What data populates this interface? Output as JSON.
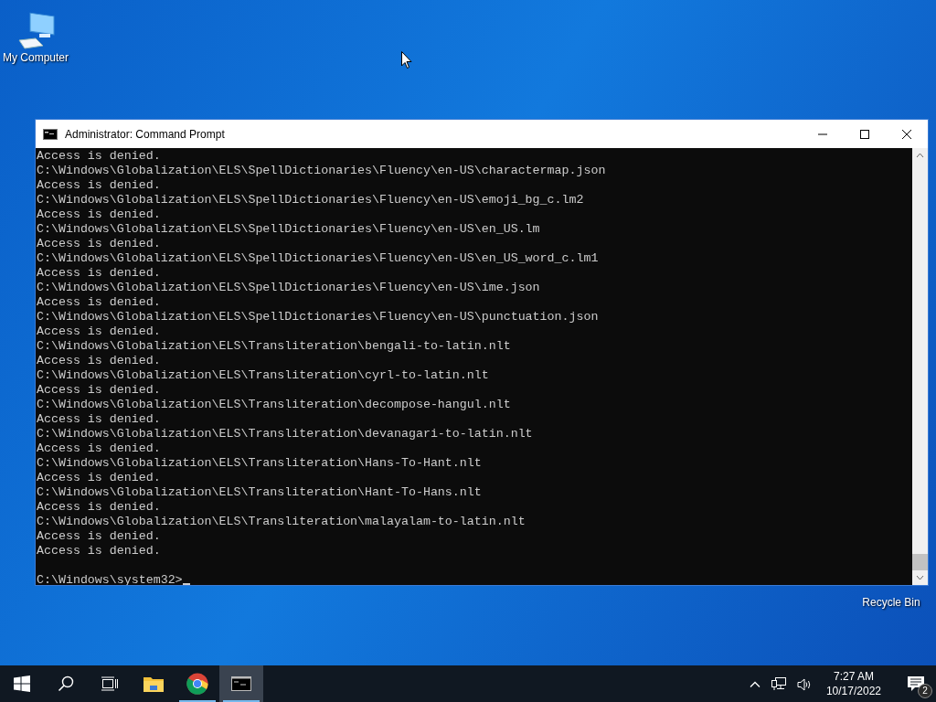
{
  "desktop_icons": [
    {
      "kind": "computer",
      "label": "My Computer"
    },
    {
      "kind": "recycle",
      "label": "Recycle Bin"
    }
  ],
  "window": {
    "title": "Administrator: Command Prompt",
    "console_lines": [
      "Access is denied.",
      "C:\\Windows\\Globalization\\ELS\\SpellDictionaries\\Fluency\\en-US\\charactermap.json",
      "Access is denied.",
      "C:\\Windows\\Globalization\\ELS\\SpellDictionaries\\Fluency\\en-US\\emoji_bg_c.lm2",
      "Access is denied.",
      "C:\\Windows\\Globalization\\ELS\\SpellDictionaries\\Fluency\\en-US\\en_US.lm",
      "Access is denied.",
      "C:\\Windows\\Globalization\\ELS\\SpellDictionaries\\Fluency\\en-US\\en_US_word_c.lm1",
      "Access is denied.",
      "C:\\Windows\\Globalization\\ELS\\SpellDictionaries\\Fluency\\en-US\\ime.json",
      "Access is denied.",
      "C:\\Windows\\Globalization\\ELS\\SpellDictionaries\\Fluency\\en-US\\punctuation.json",
      "Access is denied.",
      "C:\\Windows\\Globalization\\ELS\\Transliteration\\bengali-to-latin.nlt",
      "Access is denied.",
      "C:\\Windows\\Globalization\\ELS\\Transliteration\\cyrl-to-latin.nlt",
      "Access is denied.",
      "C:\\Windows\\Globalization\\ELS\\Transliteration\\decompose-hangul.nlt",
      "Access is denied.",
      "C:\\Windows\\Globalization\\ELS\\Transliteration\\devanagari-to-latin.nlt",
      "Access is denied.",
      "C:\\Windows\\Globalization\\ELS\\Transliteration\\Hans-To-Hant.nlt",
      "Access is denied.",
      "C:\\Windows\\Globalization\\ELS\\Transliteration\\Hant-To-Hans.nlt",
      "Access is denied.",
      "C:\\Windows\\Globalization\\ELS\\Transliteration\\malayalam-to-latin.nlt",
      "Access is denied.",
      "Access is denied."
    ],
    "prompt": "C:\\Windows\\system32>"
  },
  "taskbar": {
    "apps": [
      {
        "kind": "explorer",
        "running": false,
        "selected": false
      },
      {
        "kind": "chrome",
        "running": true,
        "selected": false
      },
      {
        "kind": "cmd",
        "running": true,
        "selected": true
      }
    ],
    "time": "7:27 AM",
    "date": "10/17/2022",
    "notifications": "2"
  }
}
